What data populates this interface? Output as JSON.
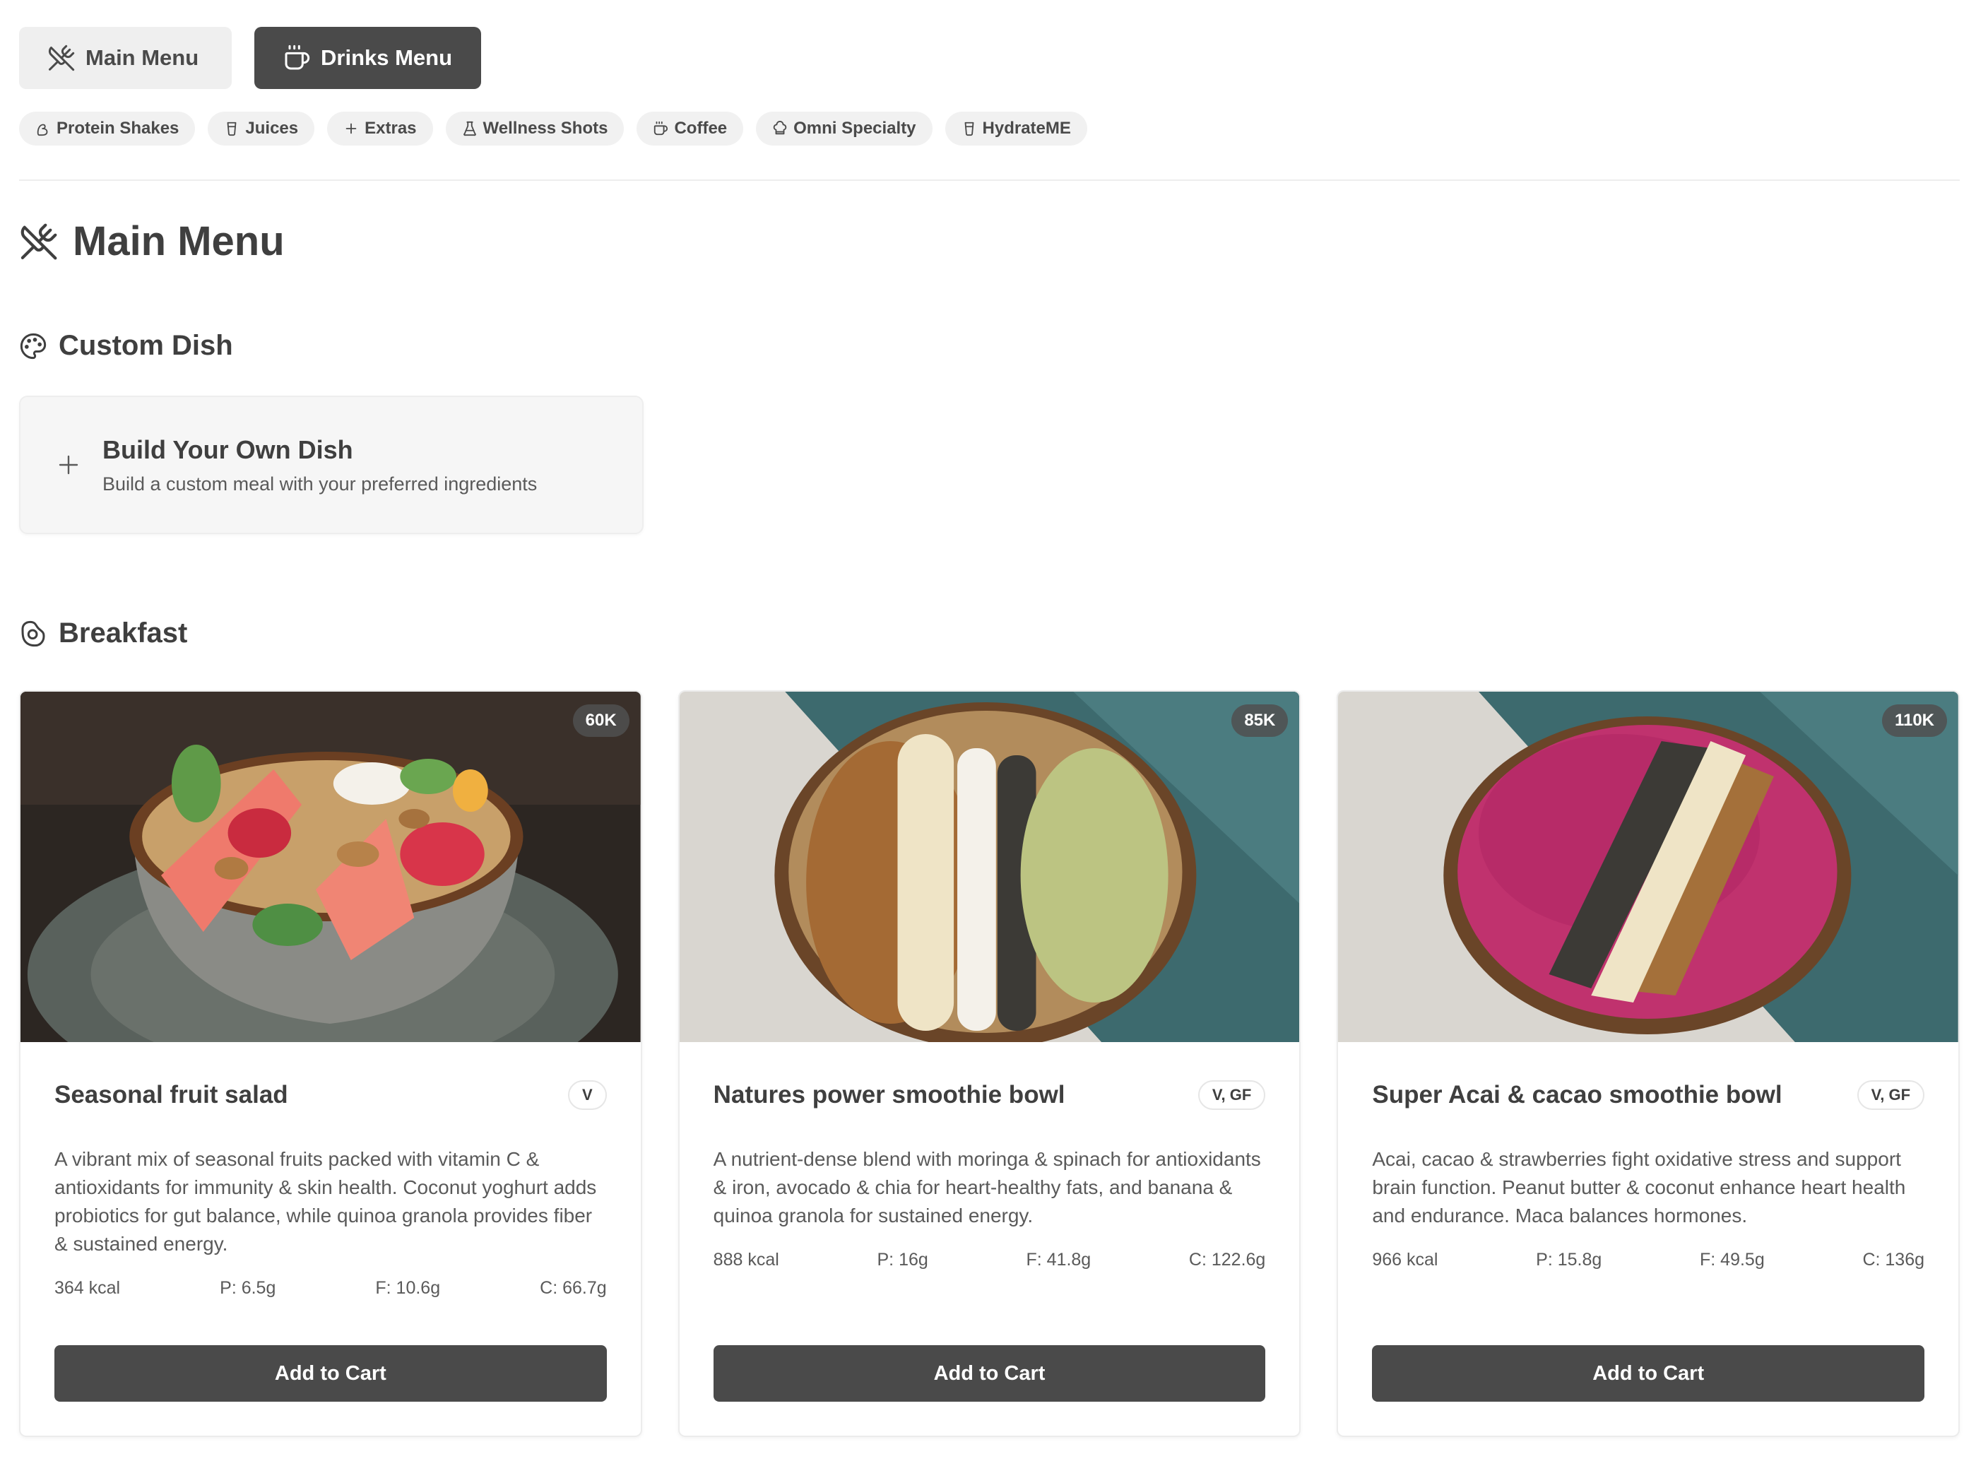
{
  "top_tabs": [
    {
      "label": "Main Menu",
      "icon": "utensils-crossed-icon",
      "active": false
    },
    {
      "label": "Drinks Menu",
      "icon": "coffee-cup-icon",
      "active": true
    }
  ],
  "categories": [
    {
      "label": "Protein Shakes",
      "icon": "bicep-icon"
    },
    {
      "label": "Juices",
      "icon": "cup-icon"
    },
    {
      "label": "Extras",
      "icon": "plus-icon"
    },
    {
      "label": "Wellness Shots",
      "icon": "flask-icon"
    },
    {
      "label": "Coffee",
      "icon": "coffee-icon"
    },
    {
      "label": "Omni Specialty",
      "icon": "chef-hat-icon"
    },
    {
      "label": "HydrateME",
      "icon": "cup-icon"
    }
  ],
  "page_title": "Main Menu",
  "custom_section": {
    "title": "Custom Dish",
    "card_title": "Build Your Own Dish",
    "card_desc": "Build a custom meal with your preferred ingredients"
  },
  "breakfast": {
    "title": "Breakfast",
    "items": [
      {
        "name": "Seasonal fruit salad",
        "price": "60K",
        "diet": "V",
        "desc": "A vibrant mix of seasonal fruits packed with vitamin C & antioxidants for immunity & skin health. Coconut yoghurt adds probiotics for gut balance, while quinoa granola provides fiber & sustained energy.",
        "kcal": "364 kcal",
        "protein": "P: 6.5g",
        "fat": "F: 10.6g",
        "carbs": "C: 66.7g",
        "cta": "Add to Cart"
      },
      {
        "name": "Natures power smoothie bowl",
        "price": "85K",
        "diet": "V, GF",
        "desc": "A nutrient-dense blend with moringa & spinach for antioxidants & iron, avocado & chia for heart-healthy fats, and banana & quinoa granola for sustained energy.",
        "kcal": "888 kcal",
        "protein": "P: 16g",
        "fat": "F: 41.8g",
        "carbs": "C: 122.6g",
        "cta": "Add to Cart"
      },
      {
        "name": "Super Acai & cacao smoothie bowl",
        "price": "110K",
        "diet": "V, GF",
        "desc": "Acai, cacao & strawberries fight oxidative stress and support brain function. Peanut butter & coconut enhance heart health and endurance. Maca balances hormones.",
        "kcal": "966 kcal",
        "protein": "P: 15.8g",
        "fat": "F: 49.5g",
        "carbs": "C: 136g",
        "cta": "Add to Cart"
      }
    ]
  }
}
